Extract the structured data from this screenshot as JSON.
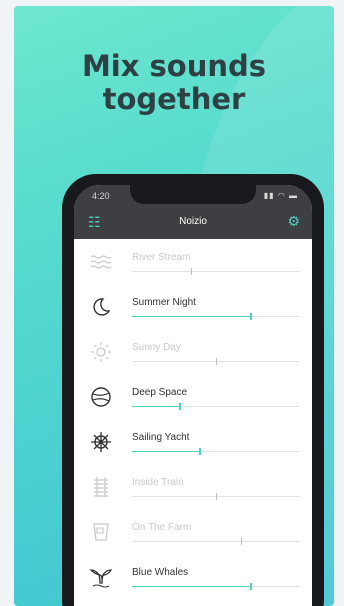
{
  "headline": {
    "line1": "Mix sounds",
    "line2": "together"
  },
  "phone": {
    "time": "4:20",
    "status_icons": "▮▮ ◠ ▬",
    "app_title": "Noizio",
    "left_icon": "list-check-icon",
    "right_icon": "gear-icon"
  },
  "colors": {
    "accent": "#4fd1c0",
    "bar": "#3d3f42",
    "text": "#333333",
    "muted": "#c9c9c9"
  },
  "sounds": [
    {
      "name": "River Stream",
      "icon": "water-waves-icon",
      "active": false,
      "volume": 0.35
    },
    {
      "name": "Summer Night",
      "icon": "moon-icon",
      "active": true,
      "volume": 0.7
    },
    {
      "name": "Sunny Day",
      "icon": "sun-icon",
      "active": false,
      "volume": 0.5
    },
    {
      "name": "Deep Space",
      "icon": "planet-icon",
      "active": true,
      "volume": 0.28
    },
    {
      "name": "Sailing Yacht",
      "icon": "ship-wheel-icon",
      "active": true,
      "volume": 0.4
    },
    {
      "name": "Inside Train",
      "icon": "train-track-icon",
      "active": false,
      "volume": 0.5
    },
    {
      "name": "On The Farm",
      "icon": "milk-bucket-icon",
      "active": false,
      "volume": 0.65
    },
    {
      "name": "Blue Whales",
      "icon": "whale-tail-icon",
      "active": true,
      "volume": 0.7
    }
  ]
}
